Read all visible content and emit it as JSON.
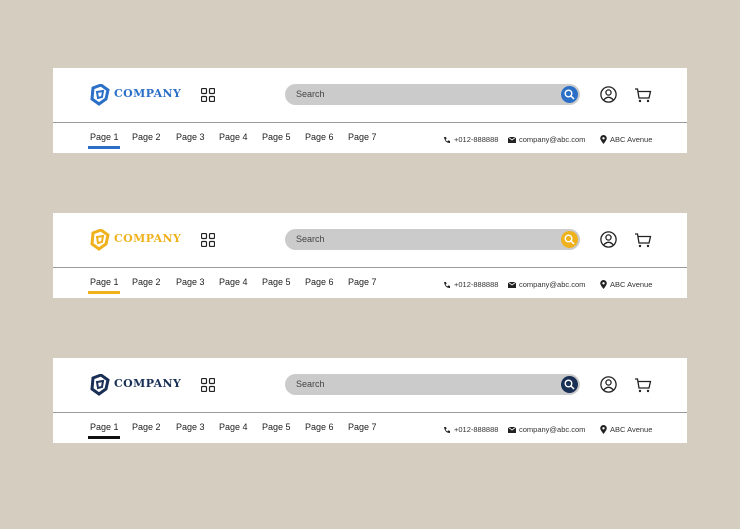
{
  "variants": [
    {
      "brand": "COMPANY",
      "accent": "#2b6fc7",
      "search_placeholder": "Search",
      "nav": [
        "Page 1",
        "Page 2",
        "Page 3",
        "Page 4",
        "Page 5",
        "Page 6",
        "Page 7"
      ],
      "phone": "+012-888888",
      "email": "company@abc.com",
      "address": "ABC Avenue"
    },
    {
      "brand": "COMPANY",
      "accent": "#efb21d",
      "search_placeholder": "Search",
      "nav": [
        "Page 1",
        "Page 2",
        "Page 3",
        "Page 4",
        "Page 5",
        "Page 6",
        "Page 7"
      ],
      "phone": "+012-888888",
      "email": "company@abc.com",
      "address": "ABC Avenue"
    },
    {
      "brand": "COMPANY",
      "accent": "#1a2f55",
      "search_placeholder": "Search",
      "nav": [
        "Page 1",
        "Page 2",
        "Page 3",
        "Page 4",
        "Page 5",
        "Page 6",
        "Page 7"
      ],
      "phone": "+012-888888",
      "email": "company@abc.com",
      "address": "ABC Avenue"
    }
  ],
  "icons": [
    "company-logo-icon",
    "grid-icon",
    "search-icon",
    "user-icon",
    "cart-icon",
    "phone-icon",
    "mail-icon",
    "location-pin-icon"
  ]
}
